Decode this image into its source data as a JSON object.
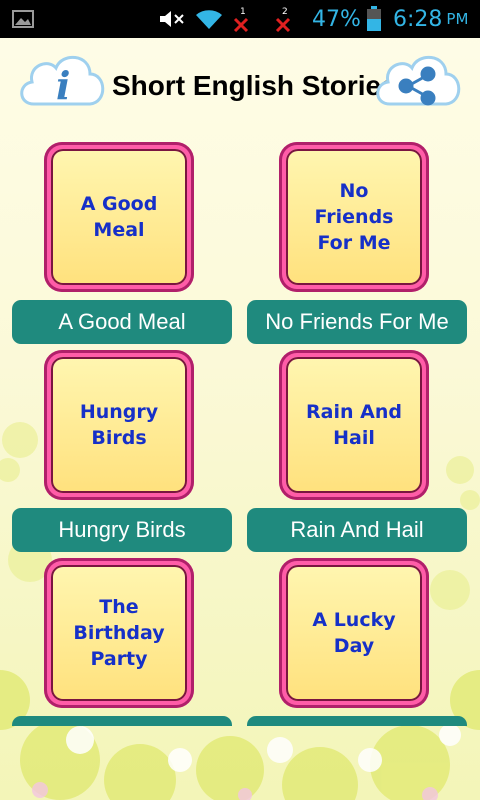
{
  "status_bar": {
    "battery_percent": "47%",
    "time": "6:28",
    "ampm": "PM",
    "sim1": "1",
    "sim2": "2",
    "icons": [
      "gallery-icon",
      "mute-icon",
      "wifi-icon",
      "sim1-no-signal-icon",
      "sim2-no-signal-icon",
      "battery-icon"
    ]
  },
  "header": {
    "title": "Short English Stories",
    "info_glyph": "i",
    "icons": [
      "info-cloud-icon",
      "share-cloud-icon"
    ]
  },
  "stories": [
    {
      "thumb_text": "A Good\nMeal",
      "label": "A Good Meal"
    },
    {
      "thumb_text": "No\nFriends\nFor Me",
      "label": "No Friends For Me"
    },
    {
      "thumb_text": "Hungry\nBirds",
      "label": "Hungry Birds"
    },
    {
      "thumb_text": "Rain And\nHail",
      "label": "Rain And Hail"
    },
    {
      "thumb_text": "The\nBirthday\nParty",
      "label": ""
    },
    {
      "thumb_text": "A Lucky\nDay",
      "label": ""
    }
  ],
  "colors": {
    "accent_teal": "#1f8a7e",
    "thumb_border_pink": "#ff5ca8",
    "thumb_text_blue": "#1630c8",
    "status_blue": "#33b5e5"
  }
}
